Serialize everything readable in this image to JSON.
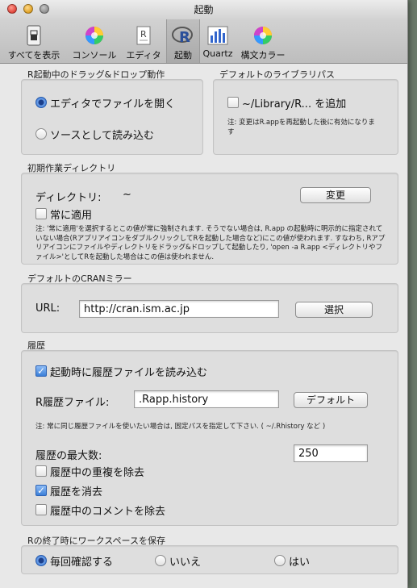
{
  "window": {
    "title": "起動"
  },
  "toolbar": {
    "items": [
      {
        "label": "すべてを表示",
        "icon": "switch-icon"
      },
      {
        "label": "コンソール",
        "icon": "color-wheel-icon"
      },
      {
        "label": "エディタ",
        "icon": "document-icon"
      },
      {
        "label": "起動",
        "icon": "r-logo-icon"
      },
      {
        "label": "Quartz",
        "icon": "chart-icon"
      },
      {
        "label": "構文カラー",
        "icon": "color-wheel-icon"
      }
    ],
    "selected": "起動"
  },
  "dragdrop": {
    "title": "R起動中のドラッグ&ドロップ動作",
    "option_editor": "エディタでファイルを開く",
    "option_source": "ソースとして読み込む",
    "selected": "エディタでファイルを開く"
  },
  "library": {
    "title": "デフォルトのライブラリパス",
    "add_label": "~/Library/R... を追加",
    "checked": false,
    "note": "注: 変更はR.appを再起動した後に有効になります"
  },
  "workdir": {
    "title": "初期作業ディレクトリ",
    "dir_label": "ディレクトリ:",
    "dir_value": "~",
    "change_button": "変更",
    "always_apply": "常に適用",
    "always_checked": false,
    "note": "注: '常に適用'を選択するとこの値が常に強制されます. そうでない場合は, R.app の起動時に明示的に指定されていない場合(RアプリアイコンをダブルクリックしてRを起動した場合など)にこの値が使われます. すなわち, Rアプリアイコンにファイルやディレクトリをドラッグ&ドロップして起動したり, 'open -a R.app <ディレクトリやファイル>'としてRを起動した場合はこの値は使われません."
  },
  "cran": {
    "title": "デフォルトのCRANミラー",
    "url_label": "URL:",
    "url_value": "http://cran.ism.ac.jp",
    "select_button": "選択"
  },
  "history": {
    "title": "履歴",
    "load_on_start": "起動時に履歴ファイルを読み込む",
    "load_checked": true,
    "file_label": "R履歴ファイル:",
    "file_value": ".Rapp.history",
    "default_button": "デフォルト",
    "note": "注: 常に同じ履歴ファイルを使いたい場合は, 固定パスを指定して下さい. ( ~/.Rhistory など )",
    "max_label": "履歴の最大数:",
    "max_value": "250",
    "remove_dup": "履歴中の重複を除去",
    "remove_dup_checked": false,
    "clean": "履歴を消去",
    "clean_checked": true,
    "remove_comments": "履歴中のコメントを除去",
    "remove_comments_checked": false
  },
  "workspace": {
    "title": "Rの終了時にワークスペースを保存",
    "ask": "毎回確認する",
    "no": "いいえ",
    "yes": "はい",
    "selected": "毎回確認する"
  },
  "colors": {
    "accent": "#3a77d6",
    "selected_tab": "#a9a9a9"
  }
}
